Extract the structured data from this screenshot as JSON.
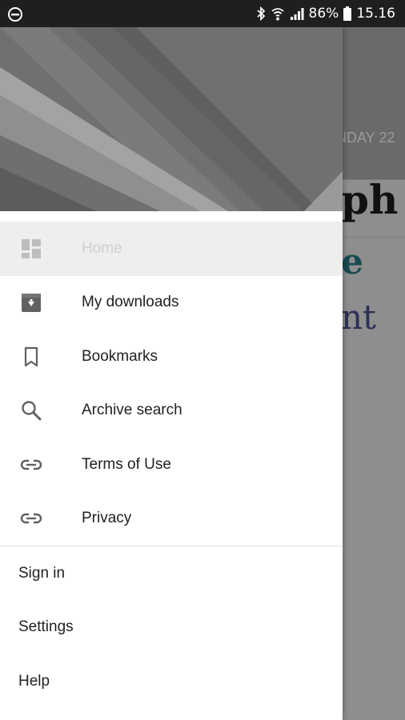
{
  "status_bar": {
    "battery": "86%",
    "time": "15.16"
  },
  "background_app": {
    "date_text": "NDAY 22",
    "title_fragment_1": "ph",
    "title_fragment_2": "e",
    "title_fragment_3": "nt"
  },
  "drawer": {
    "primary_items": [
      {
        "label": "Home",
        "icon": "dashboard-icon",
        "active": true
      },
      {
        "label": "My downloads",
        "icon": "download-box-icon"
      },
      {
        "label": "Bookmarks",
        "icon": "bookmark-icon"
      },
      {
        "label": "Archive search",
        "icon": "search-icon"
      },
      {
        "label": "Terms of Use",
        "icon": "link-icon"
      },
      {
        "label": "Privacy",
        "icon": "link-icon"
      }
    ],
    "secondary_items": [
      {
        "label": "Sign in"
      },
      {
        "label": "Settings"
      },
      {
        "label": "Help"
      }
    ]
  }
}
